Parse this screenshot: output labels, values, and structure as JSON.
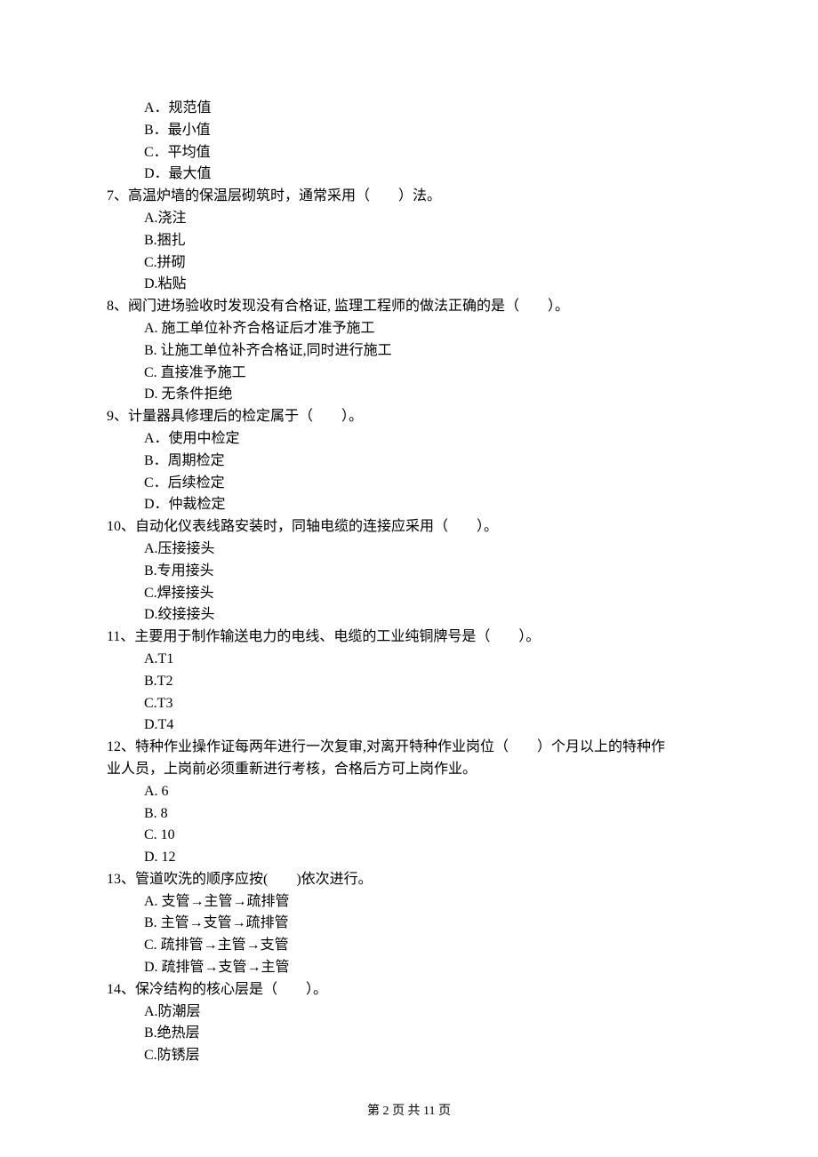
{
  "pre_options": {
    "A": "A．规范值",
    "B": "B．最小值",
    "C": "C．平均值",
    "D": "D．最大值"
  },
  "questions": [
    {
      "stem": "7、高温炉墙的保温层砌筑时，通常采用（　　）法。",
      "opts": [
        "A.浇注",
        "B.捆扎",
        "C.拼砌",
        "D.粘贴"
      ]
    },
    {
      "stem": "8、阀门进场验收时发现没有合格证, 监理工程师的做法正确的是（　　）。",
      "opts": [
        "A. 施工单位补齐合格证后才准予施工",
        "B. 让施工单位补齐合格证,同时进行施工",
        "C. 直接准予施工",
        "D. 无条件拒绝"
      ]
    },
    {
      "stem": "9、计量器具修理后的检定属于（　　）。",
      "opts": [
        "A．使用中检定",
        "B．周期检定",
        "C．后续检定",
        "D．仲裁检定"
      ]
    },
    {
      "stem": "10、自动化仪表线路安装时，同轴电缆的连接应采用（　　）。",
      "opts": [
        "A.压接接头",
        "B.专用接头",
        "C.焊接接头",
        "D.绞接接头"
      ]
    },
    {
      "stem": "11、主要用于制作输送电力的电线、电缆的工业纯铜牌号是（　　）。",
      "opts": [
        "A.T1",
        "B.T2",
        "C.T3",
        "D.T4"
      ]
    },
    {
      "stem": "12、特种作业操作证每两年进行一次复审,对离开特种作业岗位（　　）个月以上的特种作",
      "stem2": "业人员，上岗前必须重新进行考核，合格后方可上岗作业。",
      "opts": [
        "A. 6",
        "B. 8",
        "C. 10",
        "D. 12"
      ]
    },
    {
      "stem": "13、管道吹洗的顺序应按(　　)依次进行。",
      "opts": [
        "A. 支管→主管→疏排管",
        "B. 主管→支管→疏排管",
        "C. 疏排管→主管→支管",
        "D. 疏排管→支管→主管"
      ]
    },
    {
      "stem": "14、保冷结构的核心层是（　　）。",
      "opts": [
        "A.防潮层",
        "B.绝热层",
        "C.防锈层"
      ]
    }
  ],
  "footer": "第 2 页 共 11 页"
}
